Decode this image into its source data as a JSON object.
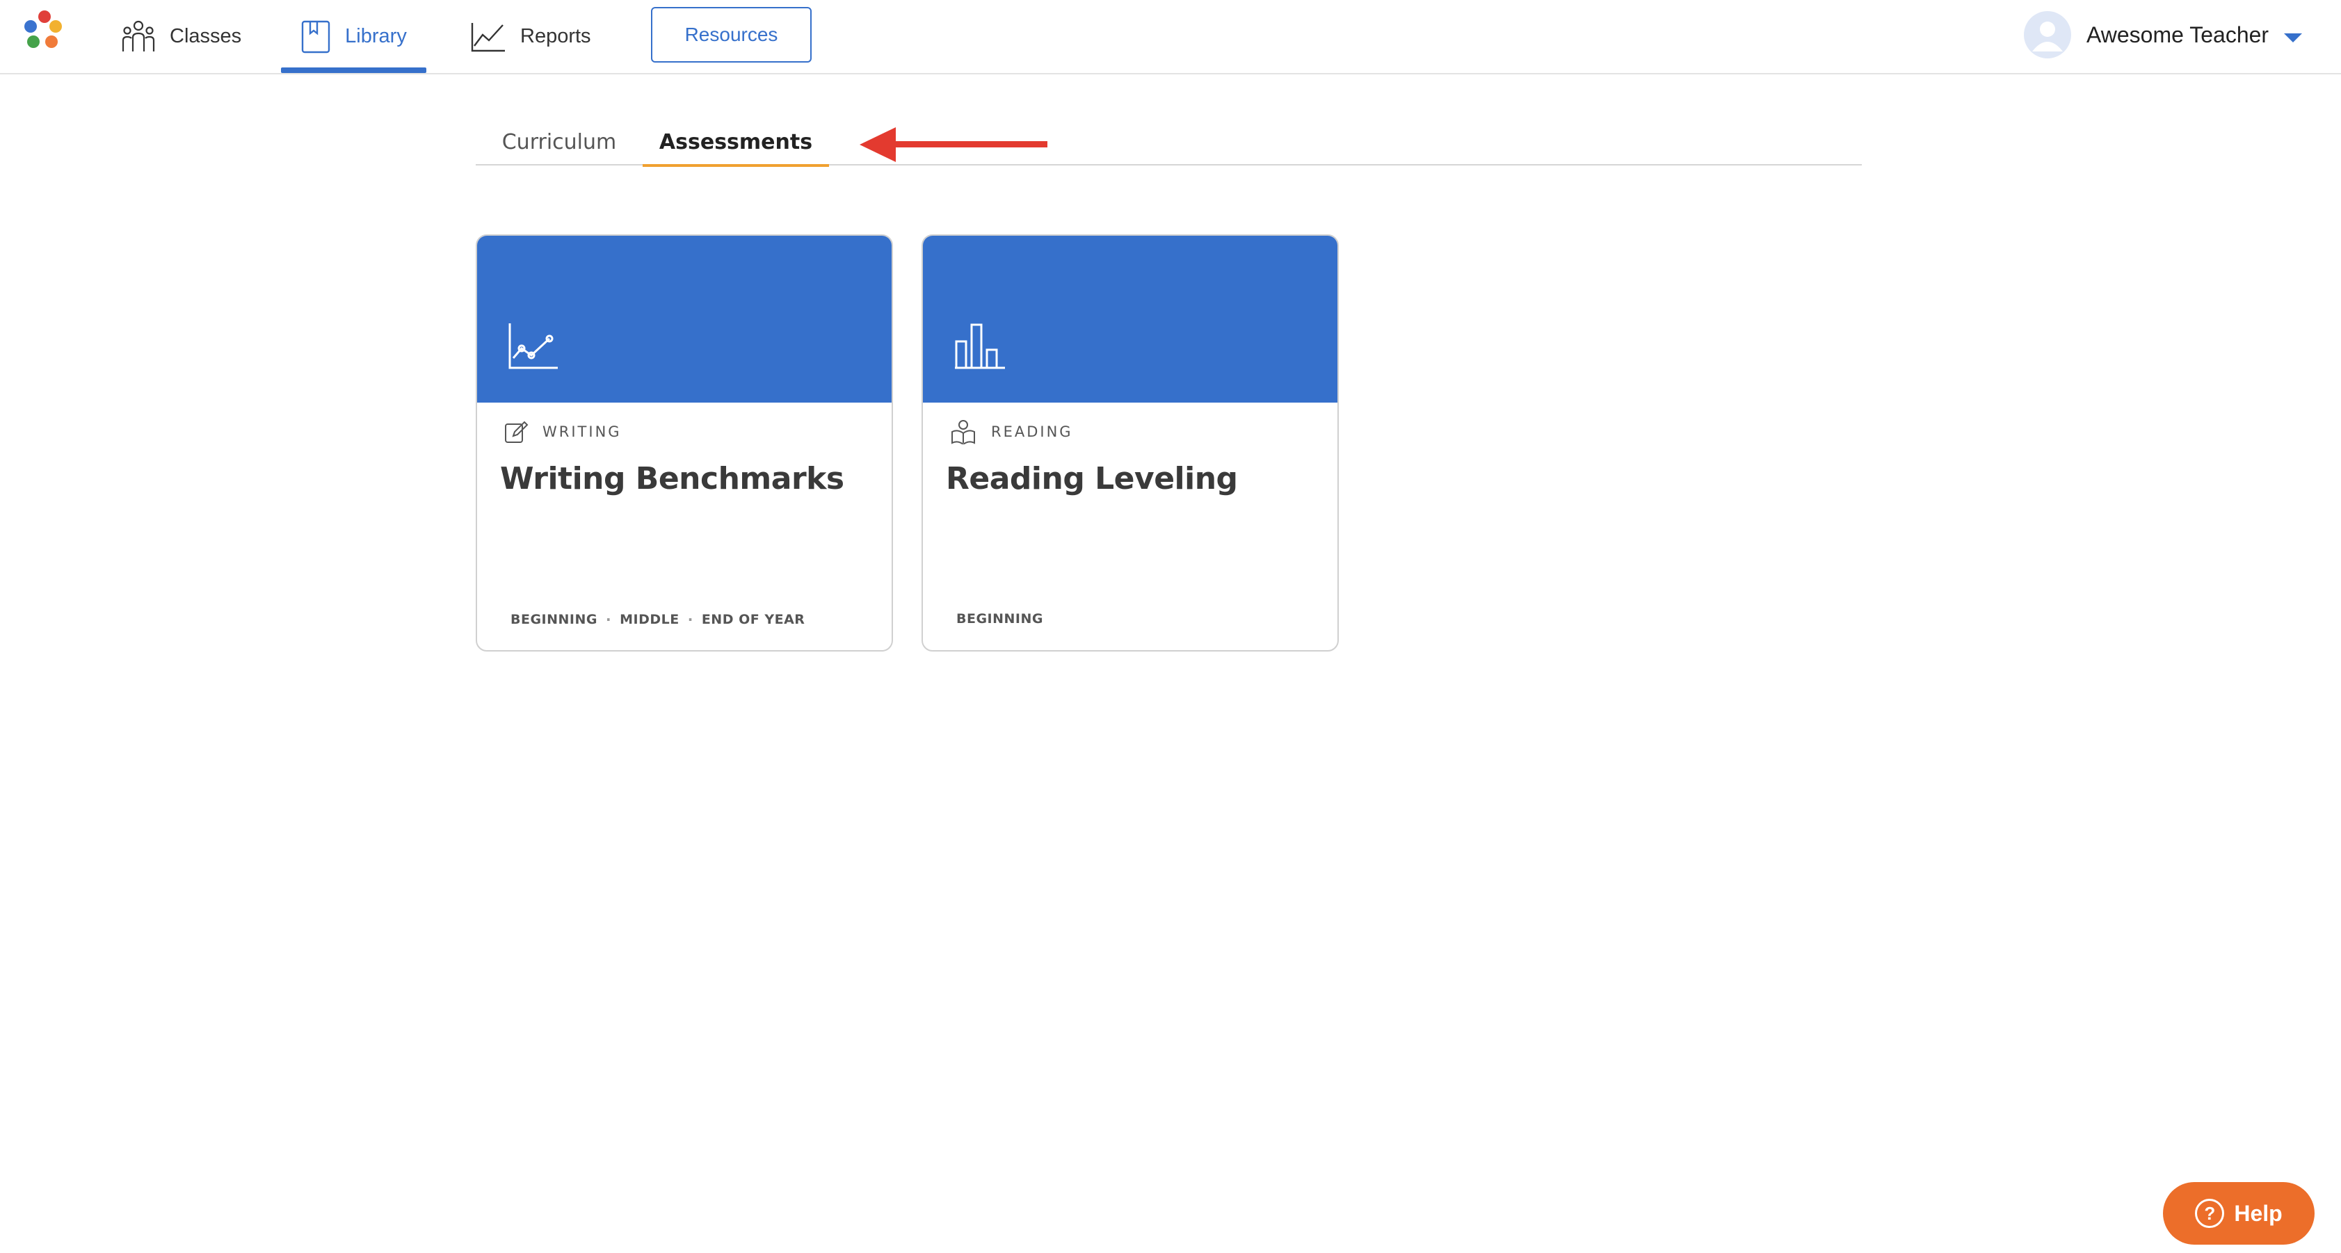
{
  "nav": {
    "logo_name": "app-logo",
    "items": [
      {
        "label": "Classes",
        "icon": "people-icon"
      },
      {
        "label": "Library",
        "icon": "bookmark-book-icon",
        "active": true
      },
      {
        "label": "Reports",
        "icon": "line-chart-icon"
      }
    ],
    "resources_label": "Resources",
    "user_name": "Awesome Teacher"
  },
  "tabs": {
    "items": [
      "Curriculum",
      "Assessments"
    ],
    "active": "Assessments"
  },
  "cards": [
    {
      "category": "WRITING",
      "category_icon": "edit-note-icon",
      "header_icon": "line-graph-icon",
      "title": "Writing Benchmarks",
      "tags": [
        "BEGINNING",
        "MIDDLE",
        "END OF YEAR"
      ]
    },
    {
      "category": "READING",
      "category_icon": "reader-icon",
      "header_icon": "bar-chart-icon",
      "title": "Reading Leveling",
      "tags": [
        "BEGINNING"
      ]
    }
  ],
  "help": {
    "label": "Help",
    "icon": "?"
  },
  "colors": {
    "accent": "#3670cb",
    "tab_underline": "#f0a030",
    "annotation_arrow": "#e33a2f",
    "help_button": "#ec6e2a"
  }
}
